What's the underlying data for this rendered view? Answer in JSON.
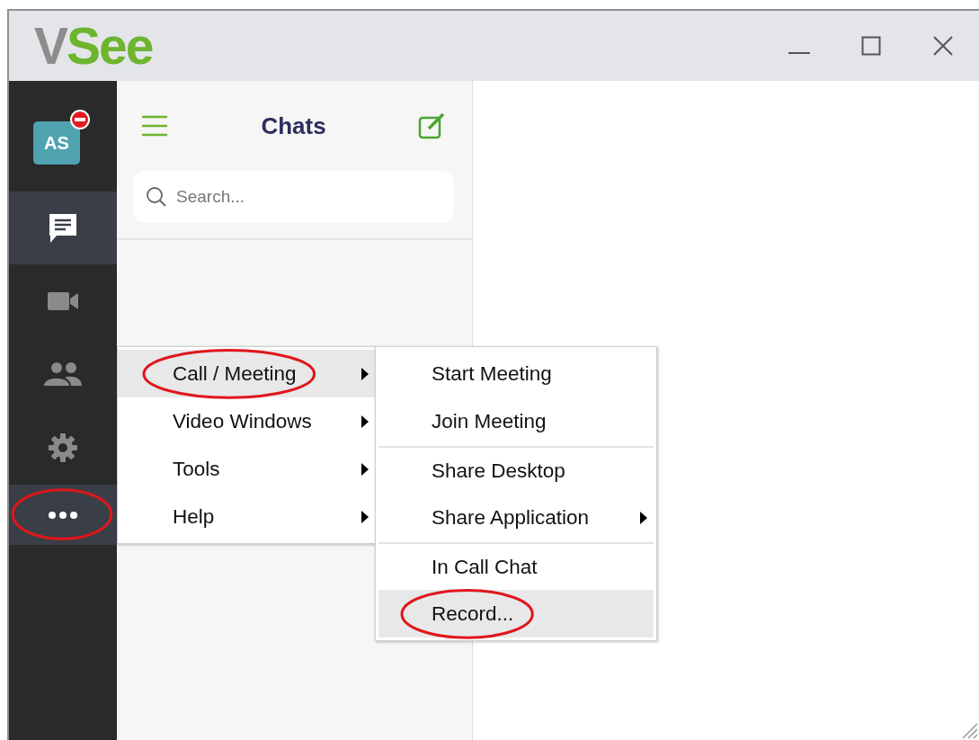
{
  "window": {
    "logo": [
      {
        "text": "V",
        "color": "#8c8c8c"
      },
      {
        "text": "See",
        "color": "#6db42f"
      }
    ]
  },
  "rail": {
    "avatar": {
      "initials": "AS",
      "busy": true
    },
    "items": [
      {
        "kind": "chat",
        "selected": true,
        "circled": false
      },
      {
        "kind": "video",
        "selected": false,
        "circled": false
      },
      {
        "kind": "contacts",
        "selected": false,
        "circled": false
      },
      {
        "kind": "settings",
        "selected": false,
        "circled": false
      },
      {
        "kind": "more",
        "selected": true,
        "circled": true
      }
    ]
  },
  "chats": {
    "title": "Chats",
    "search": {
      "placeholder": "Search..."
    }
  },
  "menu": [
    {
      "label": "Call / Meeting",
      "selected": true,
      "submenu": true,
      "circled": true
    },
    {
      "label": "Video Windows",
      "selected": false,
      "submenu": true,
      "circled": false
    },
    {
      "label": "Tools",
      "selected": false,
      "submenu": true,
      "circled": false
    },
    {
      "label": "Help",
      "selected": false,
      "submenu": true,
      "circled": false
    }
  ],
  "submenu": [
    {
      "label": "Start Meeting",
      "selected": false,
      "submenu": false,
      "separator_before": false,
      "circled": false
    },
    {
      "label": "Join Meeting",
      "selected": false,
      "submenu": false,
      "separator_before": false,
      "circled": false
    },
    {
      "label": "Share Desktop",
      "selected": false,
      "submenu": false,
      "separator_before": true,
      "circled": false
    },
    {
      "label": "Share Application",
      "selected": false,
      "submenu": true,
      "separator_before": false,
      "circled": false
    },
    {
      "label": "In Call Chat",
      "selected": false,
      "submenu": false,
      "separator_before": true,
      "circled": false
    },
    {
      "label": "Record...",
      "selected": true,
      "submenu": false,
      "separator_before": false,
      "circled": true
    }
  ]
}
